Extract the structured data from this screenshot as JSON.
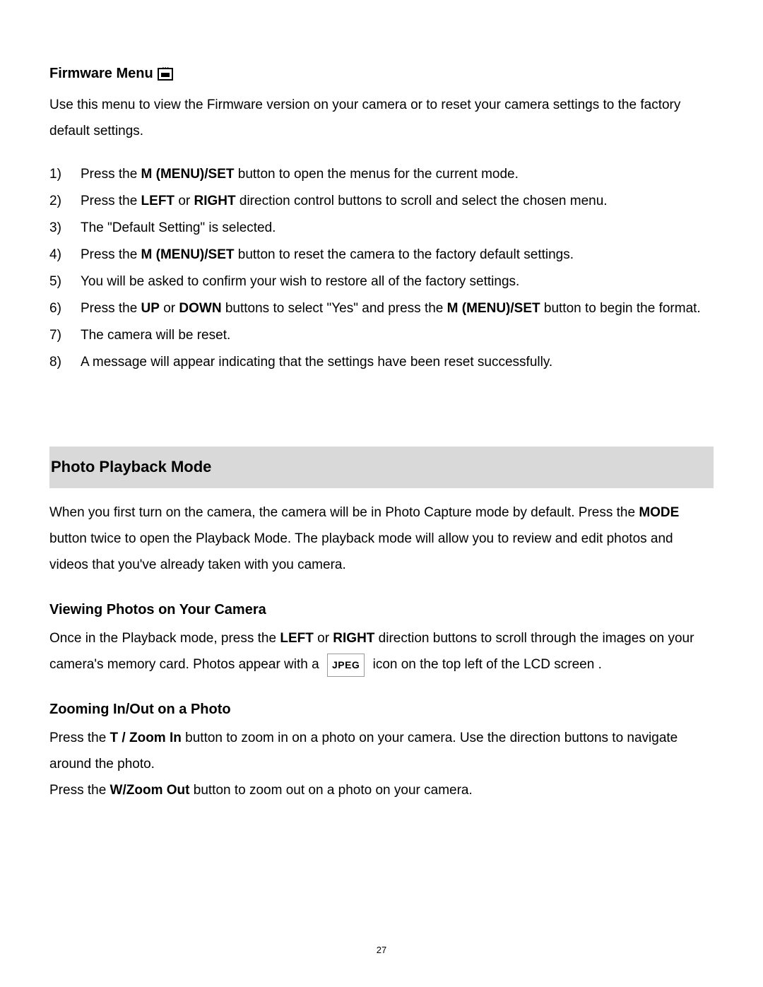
{
  "firmware": {
    "heading": "Firmware Menu",
    "intro": "Use this menu to view the Firmware version on your camera or to reset your camera settings to the factory default settings.",
    "steps": {
      "n1": "1)",
      "s1_a": "Press the ",
      "s1_b": "M (MENU)/SET",
      "s1_c": " button to open the menus for the current mode.",
      "n2": "2)",
      "s2_a": "Press the ",
      "s2_b": "LEFT",
      "s2_c": " or ",
      "s2_d": "RIGHT",
      "s2_e": " direction control buttons to scroll and select the chosen menu.",
      "n3": "3)",
      "s3": "The \"Default Setting\" is selected.",
      "n4": "4)",
      "s4_a": "Press the ",
      "s4_b": "M (MENU)/SET",
      "s4_c": " button to reset the camera to the factory default settings.",
      "n5": "5)",
      "s5": "You will be asked to confirm your wish to restore all of the factory settings.",
      "n6": "6)",
      "s6_a": "Press the ",
      "s6_b": "UP",
      "s6_c": " or ",
      "s6_d": "DOWN",
      "s6_e": " buttons to select \"Yes\" and press the ",
      "s6_f": "M (MENU)/SET",
      "s6_g": " button to begin the format.",
      "n7": "7)",
      "s7": "The camera will be reset.",
      "n8": "8)",
      "s8": "A message will appear indicating that the settings have been reset successfully."
    }
  },
  "playback": {
    "heading": "Photo Playback Mode",
    "intro_a": "When you first turn on the camera, the camera will be in Photo Capture mode by default. Press the ",
    "intro_b": "MODE",
    "intro_c": " button twice to open the Playback Mode. The playback mode will allow you to review and edit photos and videos that you've already taken with you camera."
  },
  "viewing": {
    "heading": "Viewing Photos on Your Camera",
    "p_a": "Once in the Playback mode, press the ",
    "p_b": "LEFT",
    "p_c": " or ",
    "p_d": "RIGHT",
    "p_e": " direction buttons to scroll through the images on your camera's memory card. Photos appear with a ",
    "jpeg": "JPEG",
    "p_f": " icon on the top left of the LCD screen ."
  },
  "zoom": {
    "heading": "Zooming In/Out on a Photo",
    "p1_a": "Press the ",
    "p1_b": "T / Zoom In",
    "p1_c": " button to zoom in on a photo on your camera. Use the direction buttons to navigate around the photo.",
    "p2_a": "Press the ",
    "p2_b": "W/Zoom Out",
    "p2_c": " button to zoom out on a photo on your camera."
  },
  "page_number": "27"
}
